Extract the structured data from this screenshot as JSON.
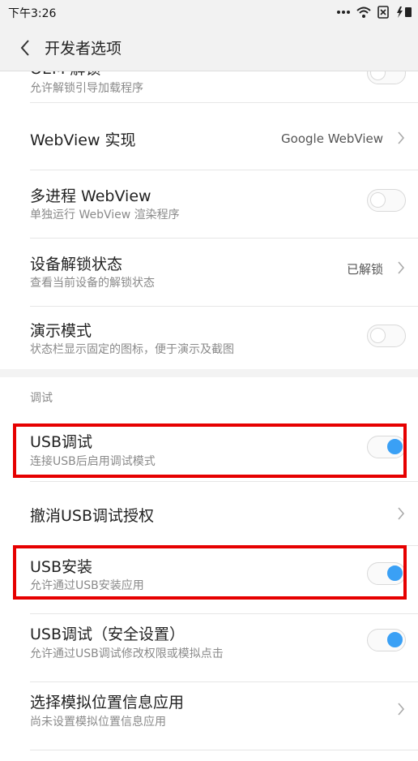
{
  "status_bar": {
    "time": "下午3:26",
    "icons": [
      "more-dots-icon",
      "wifi-icon",
      "sim-x-icon",
      "charging-icon"
    ]
  },
  "header": {
    "back_icon": "chevron-left-icon",
    "title": "开发者选项"
  },
  "items": {
    "oem_unlock": {
      "title": "OEM 解锁",
      "subtitle": "允许解锁引导加载程序",
      "toggle": "off"
    },
    "webview_impl": {
      "title": "WebView 实现",
      "value": "Google WebView"
    },
    "multiprocess_webview": {
      "title": "多进程 WebView",
      "subtitle": "单独运行 WebView 渲染程序",
      "toggle": "off"
    },
    "unlock_status": {
      "title": "设备解锁状态",
      "subtitle": "查看当前设备的解锁状态",
      "value": "已解锁"
    },
    "demo_mode": {
      "title": "演示模式",
      "subtitle": "状态栏显示固定的图标，便于演示及截图",
      "toggle": "off"
    },
    "debug_section": {
      "header": "调试"
    },
    "usb_debugging": {
      "title": "USB调试",
      "subtitle": "连接USB后启用调试模式",
      "toggle": "on"
    },
    "revoke_usb_auth": {
      "title": "撤消USB调试授权"
    },
    "usb_install": {
      "title": "USB安装",
      "subtitle": "允许通过USB安装应用",
      "toggle": "on"
    },
    "usb_debug_security": {
      "title": "USB调试（安全设置）",
      "subtitle": "允许通过USB调试修改权限或模拟点击",
      "toggle": "on"
    },
    "mock_location": {
      "title": "选择模拟位置信息应用",
      "subtitle": "尚未设置模拟位置信息应用"
    }
  },
  "colors": {
    "accent": "#3aa0f5",
    "highlight": "#e60000",
    "bar_background": "#f2f2f2"
  }
}
